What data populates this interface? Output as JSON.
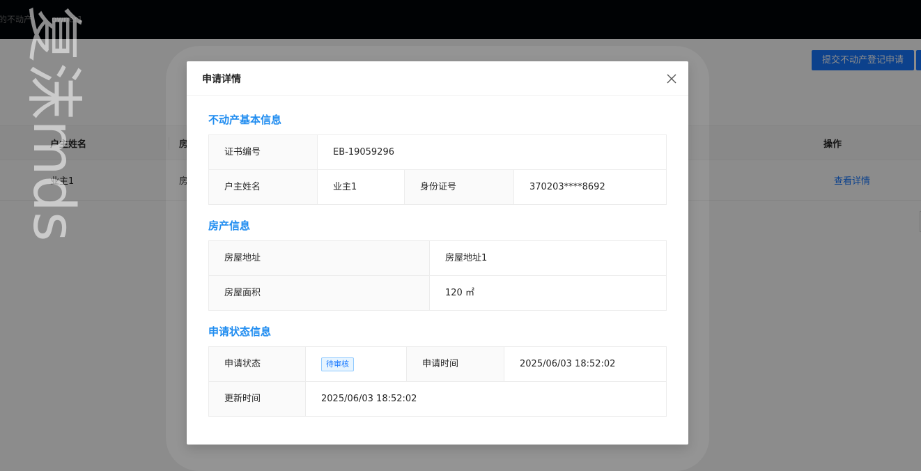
{
  "topbar": {
    "nav_text": "的不动产",
    "user": "owner1"
  },
  "toolbar": {
    "submit_label": "提交不动产登记申请",
    "second_label": ""
  },
  "table": {
    "headers": [
      "户主姓名",
      "房",
      "操作"
    ],
    "row": {
      "owner": "业主1",
      "house": "房",
      "action": "查看详情"
    }
  },
  "watermark": "复沫mds",
  "modal": {
    "title": "申请详情",
    "sections": {
      "basic": {
        "title": "不动产基本信息",
        "cert_label": "证书编号",
        "cert_value": "EB-19059296",
        "owner_label": "户主姓名",
        "owner_value": "业主1",
        "id_label": "身份证号",
        "id_value": "370203****8692"
      },
      "property": {
        "title": "房产信息",
        "address_label": "房屋地址",
        "address_value": "房屋地址1",
        "area_label": "房屋面积",
        "area_value": "120 ㎡"
      },
      "status": {
        "title": "申请状态信息",
        "status_label": "申请状态",
        "status_value": "待审核",
        "apply_time_label": "申请时间",
        "apply_time_value": "2025/06/03 18:52:02",
        "update_time_label": "更新时间",
        "update_time_value": "2025/06/03 18:52:02"
      }
    }
  },
  "colors": {
    "accent": "#1677ff",
    "section_title": "#1f8cf0",
    "topbar": "#010409"
  }
}
